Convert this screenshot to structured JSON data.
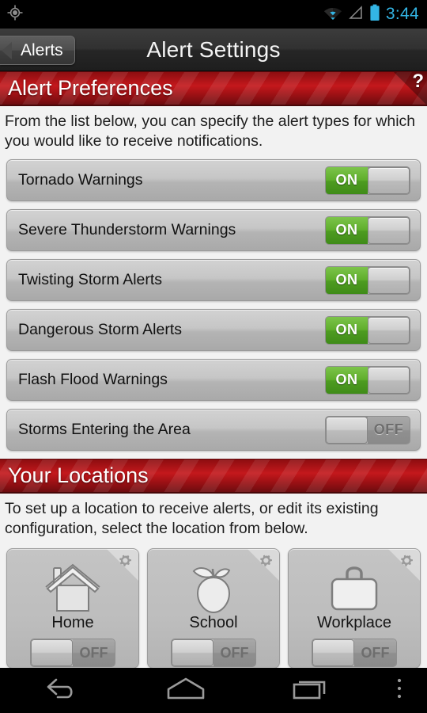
{
  "status_bar": {
    "gps_icon": "gps-crosshair-icon",
    "wifi_icon": "wifi-icon",
    "signal_icon": "cell-signal-icon",
    "battery_icon": "battery-icon",
    "time": "3:44",
    "clock_color": "#33b5e5"
  },
  "title_bar": {
    "back_label": "Alerts",
    "title": "Alert Settings"
  },
  "alert_preferences": {
    "header": "Alert Preferences",
    "help_glyph": "?",
    "help_icon": "question-mark-icon",
    "description": "From the list below, you can specify the alert types for which you would like to receive notifications.",
    "on_label": "ON",
    "off_label": "OFF",
    "rows": [
      {
        "label": "Tornado Warnings",
        "state": "ON"
      },
      {
        "label": "Severe Thunderstorm Warnings",
        "state": "ON"
      },
      {
        "label": "Twisting Storm Alerts",
        "state": "ON"
      },
      {
        "label": "Dangerous Storm Alerts",
        "state": "ON"
      },
      {
        "label": "Flash Flood Warnings",
        "state": "ON"
      },
      {
        "label": "Storms Entering the Area",
        "state": "OFF"
      }
    ]
  },
  "your_locations": {
    "header": "Your Locations",
    "description": "To set up a location to receive alerts, or edit its existing configuration, select the location from below.",
    "cards": [
      {
        "name": "Home",
        "icon": "house-icon",
        "gear_icon": "gear-icon",
        "toggle_label": "OFF"
      },
      {
        "name": "School",
        "icon": "apple-icon",
        "gear_icon": "gear-icon",
        "toggle_label": "OFF"
      },
      {
        "name": "Workplace",
        "icon": "briefcase-icon",
        "gear_icon": "gear-icon",
        "toggle_label": "OFF"
      }
    ]
  },
  "nav_bar": {
    "back_icon": "back-arrow-icon",
    "home_icon": "home-icon",
    "recents_icon": "recent-apps-icon",
    "overflow_icon": "overflow-menu-icon"
  },
  "colors": {
    "accent_red": "#b01217",
    "toggle_green": "#5fae2c",
    "page_background": "#f2f2f2"
  }
}
